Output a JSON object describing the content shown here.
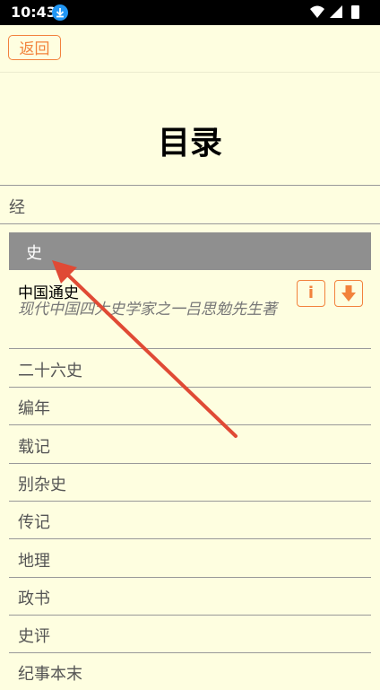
{
  "status": {
    "time": "10:43"
  },
  "header": {
    "back_label": "返回",
    "title": "目录"
  },
  "sections": {
    "jing": "经"
  },
  "category": {
    "label": "史",
    "book": {
      "title": "中国通史",
      "subtitle": "现代中国四大史学家之一吕思勉先生著",
      "info_label": "i"
    },
    "items": [
      "二十六史",
      "编年",
      "载记",
      "别杂史",
      "传记",
      "地理",
      "政书",
      "史评",
      "纪事本末"
    ]
  },
  "colors": {
    "accent": "#f2823c",
    "background": "#fefee0",
    "selected": "#8f8f8f",
    "annotation": "#e04a35"
  }
}
